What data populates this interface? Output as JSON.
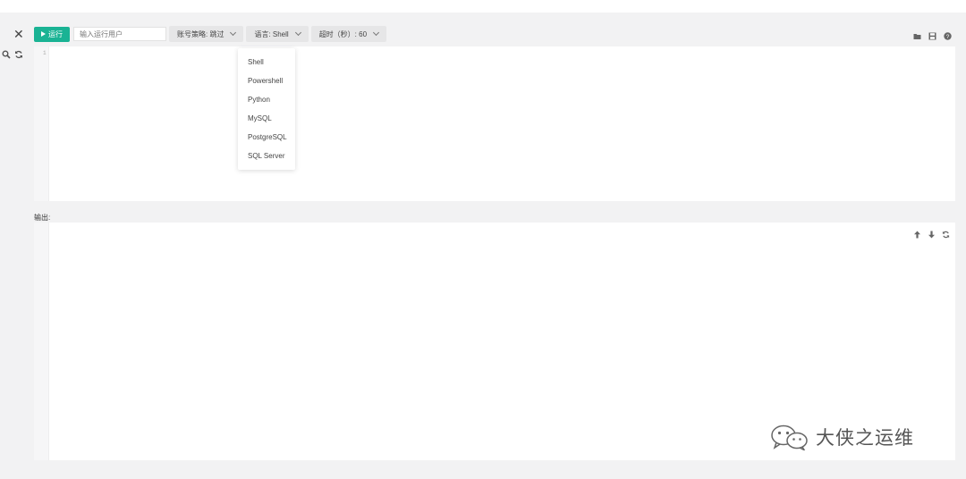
{
  "toolbar": {
    "run_label": "运行",
    "user_input_placeholder": "输入运行用户",
    "account_policy": "账号策略: 跳过",
    "language": "语言: Shell",
    "timeout": "超时（秒）: 60"
  },
  "editor": {
    "line_numbers": [
      "1"
    ]
  },
  "language_menu": {
    "options": [
      "Shell",
      "Powershell",
      "Python",
      "MySQL",
      "PostgreSQL",
      "SQL Server"
    ]
  },
  "output": {
    "label": "输出:"
  },
  "watermark": {
    "text": "大侠之运维"
  },
  "icons": {
    "close": "close-icon",
    "search": "search-icon",
    "refresh": "refresh-icon",
    "folder": "folder-icon",
    "save": "save-icon",
    "help": "help-icon",
    "up": "arrow-up-icon",
    "down": "arrow-down-icon",
    "out_refresh": "refresh-icon"
  },
  "colors": {
    "accent": "#1ab394",
    "background": "#f2f2f3",
    "panel": "#ffffff"
  }
}
